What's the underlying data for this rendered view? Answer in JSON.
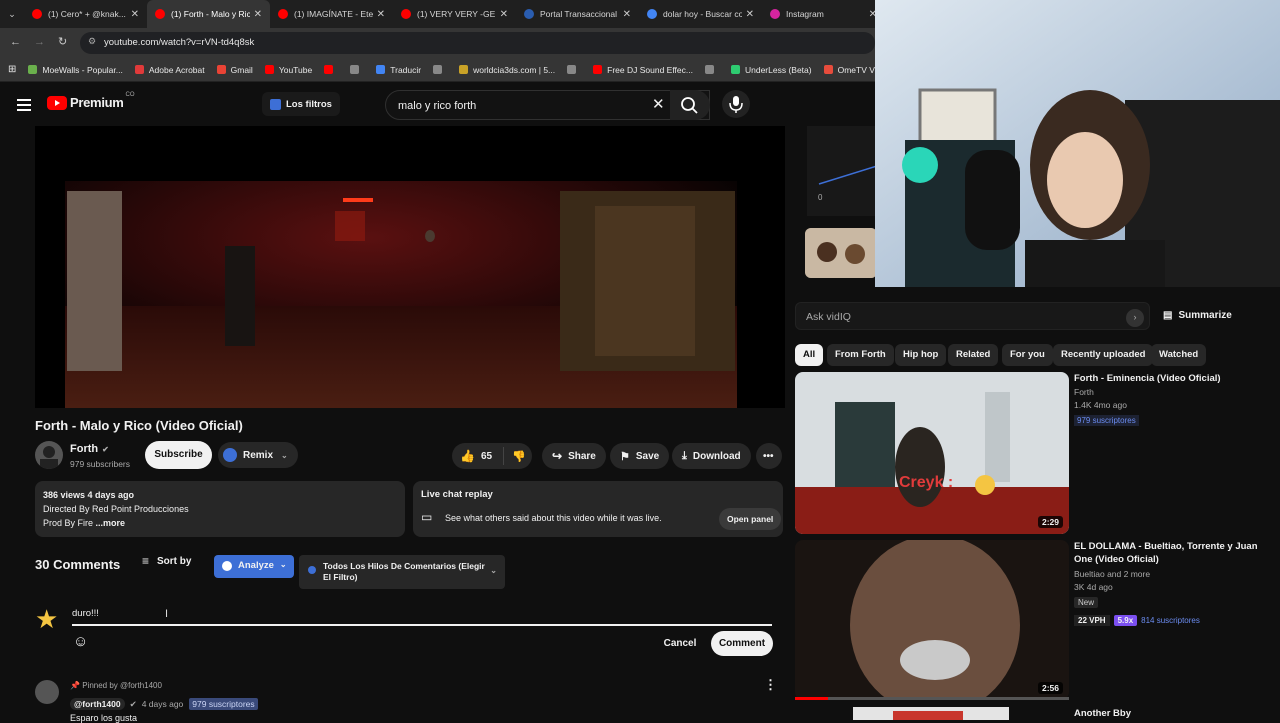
{
  "browser": {
    "tabs": [
      {
        "title": "(1) Cero* + @knak...",
        "color": "#ff0000"
      },
      {
        "title": "(1) Forth - Malo y Rico",
        "color": "#ff0000",
        "active": true
      },
      {
        "title": "(1) IMAGÍNATE - Eter",
        "color": "#ff0000"
      },
      {
        "title": "(1) VERY VERY -GE",
        "color": "#ff0000"
      },
      {
        "title": "Portal Transaccional",
        "color": "#2a5db0"
      },
      {
        "title": "dolar hoy - Buscar co",
        "color": "#4285f4"
      },
      {
        "title": "Instagram",
        "color": "#d6249f"
      }
    ],
    "url": "youtube.com/watch?v=rVN-td4q8sk",
    "bookmarks": [
      {
        "label": "MoeWalls - Popular...",
        "color": "#6ab04c"
      },
      {
        "label": "Adobe Acrobat",
        "color": "#e03a3a"
      },
      {
        "label": "Gmail",
        "color": "#ea4335"
      },
      {
        "label": "YouTube",
        "color": "#ff0000"
      },
      {
        "label": "",
        "color": "#ff0000"
      },
      {
        "label": "",
        "color": "#888888"
      },
      {
        "label": "Traducir",
        "color": "#4285f4"
      },
      {
        "label": "",
        "color": "#888888"
      },
      {
        "label": "worldcia3ds.com | 5...",
        "color": "#c9a227"
      },
      {
        "label": "",
        "color": "#888888"
      },
      {
        "label": "Free DJ Sound Effec...",
        "color": "#ff0000"
      },
      {
        "label": "",
        "color": "#888888"
      },
      {
        "label": "UnderLess (Beta)",
        "color": "#2ecc71"
      },
      {
        "label": "OmeTV Video Chat...",
        "color": "#e74c3c"
      }
    ]
  },
  "header": {
    "logo": "Premium",
    "logo_sup": "CO",
    "filters_label": "Los filtros",
    "search_value": "malo y rico forth"
  },
  "video": {
    "title": "Forth - Malo y Rico (Video Oficial)",
    "channel": "Forth",
    "subscribers": "979 subscribers",
    "subscribe": "Subscribe",
    "remix": "Remix",
    "likes": "65",
    "share": "Share",
    "save": "Save",
    "download": "Download",
    "views_date": "386 views  4 days ago",
    "desc_line1": "Directed By Red Point Producciones",
    "desc_line2": "Prod By Fire",
    "more": "...more",
    "chat_title": "Live chat replay",
    "chat_desc": "See what others said about this video while it was live.",
    "open_panel": "Open panel"
  },
  "comments": {
    "count": "30 Comments",
    "sort_by": "Sort by",
    "analyze": "Analyze",
    "threads_select": "Todos Los Hilos De Comentarios (Elegir El Filtro)",
    "draft": "duro!!!",
    "cancel": "Cancel",
    "comment": "Comment",
    "pinned": "Pinned by @forth1400",
    "first_author": "@forth1400",
    "first_date": "4 days ago",
    "first_badge": "979 suscriptores",
    "first_text": "Esparo los gusta"
  },
  "sidebar": {
    "ask_placeholder": "Ask vidIQ",
    "summarize": "Summarize",
    "chips": [
      "All",
      "From Forth",
      "Hip hop",
      "Related",
      "For you",
      "Recently uploaded",
      "Watched"
    ],
    "chart_zero": "0",
    "videos": [
      {
        "title": "Forth - Eminencia (Video Oficial)",
        "channel": "Forth",
        "stats": "1.4K  4mo ago",
        "badge": "979 suscriptores",
        "duration": "2:29",
        "overlay": "Creyk :"
      },
      {
        "title": "EL DOLLAMA - Bueltiao, Torrente y Juan One (Video Oficial)",
        "channel": "Bueltiao and 2 more",
        "stats": "3K  4d ago",
        "new": "New",
        "vph": "22 VPH",
        "score": "5.9x",
        "badge": "814 suscriptores",
        "duration": "2:56"
      },
      {
        "title": "Another Bby",
        "channel": "",
        "stats": "",
        "duration": ""
      }
    ]
  },
  "colors": {
    "bg": "#0f0f0f",
    "chip": "#272727",
    "vidiq": "#3d6fd6",
    "red": "#ff0000"
  }
}
